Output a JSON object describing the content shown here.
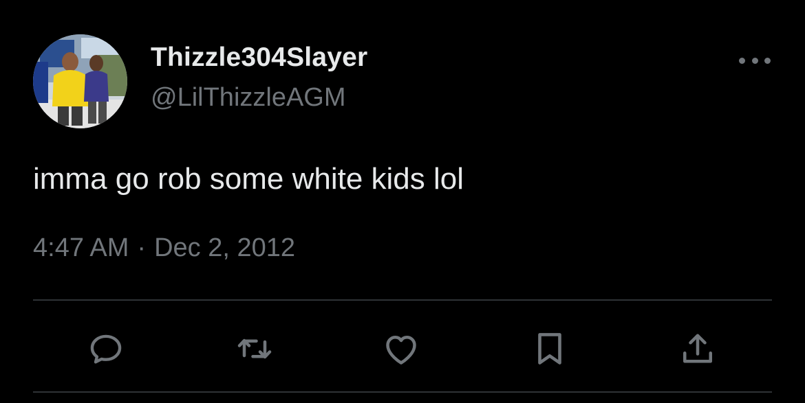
{
  "user": {
    "display_name": "Thizzle304Slayer",
    "handle": "@LilThizzleAGM",
    "avatar_icon": "profile-photo"
  },
  "tweet": {
    "text": "imma go rob some white kids lol",
    "time": "4:47 AM",
    "separator": "·",
    "date": "Dec 2, 2012"
  },
  "actions": [
    {
      "name": "reply",
      "icon": "comment-bubble-icon"
    },
    {
      "name": "retweet",
      "icon": "retweet-icon"
    },
    {
      "name": "like",
      "icon": "heart-icon"
    },
    {
      "name": "bookmark",
      "icon": "bookmark-icon"
    },
    {
      "name": "share",
      "icon": "share-upload-icon"
    }
  ],
  "colors": {
    "background": "#000000",
    "primary_text": "#e7e9ea",
    "secondary_text": "#71767b",
    "divider": "#2f3336"
  }
}
